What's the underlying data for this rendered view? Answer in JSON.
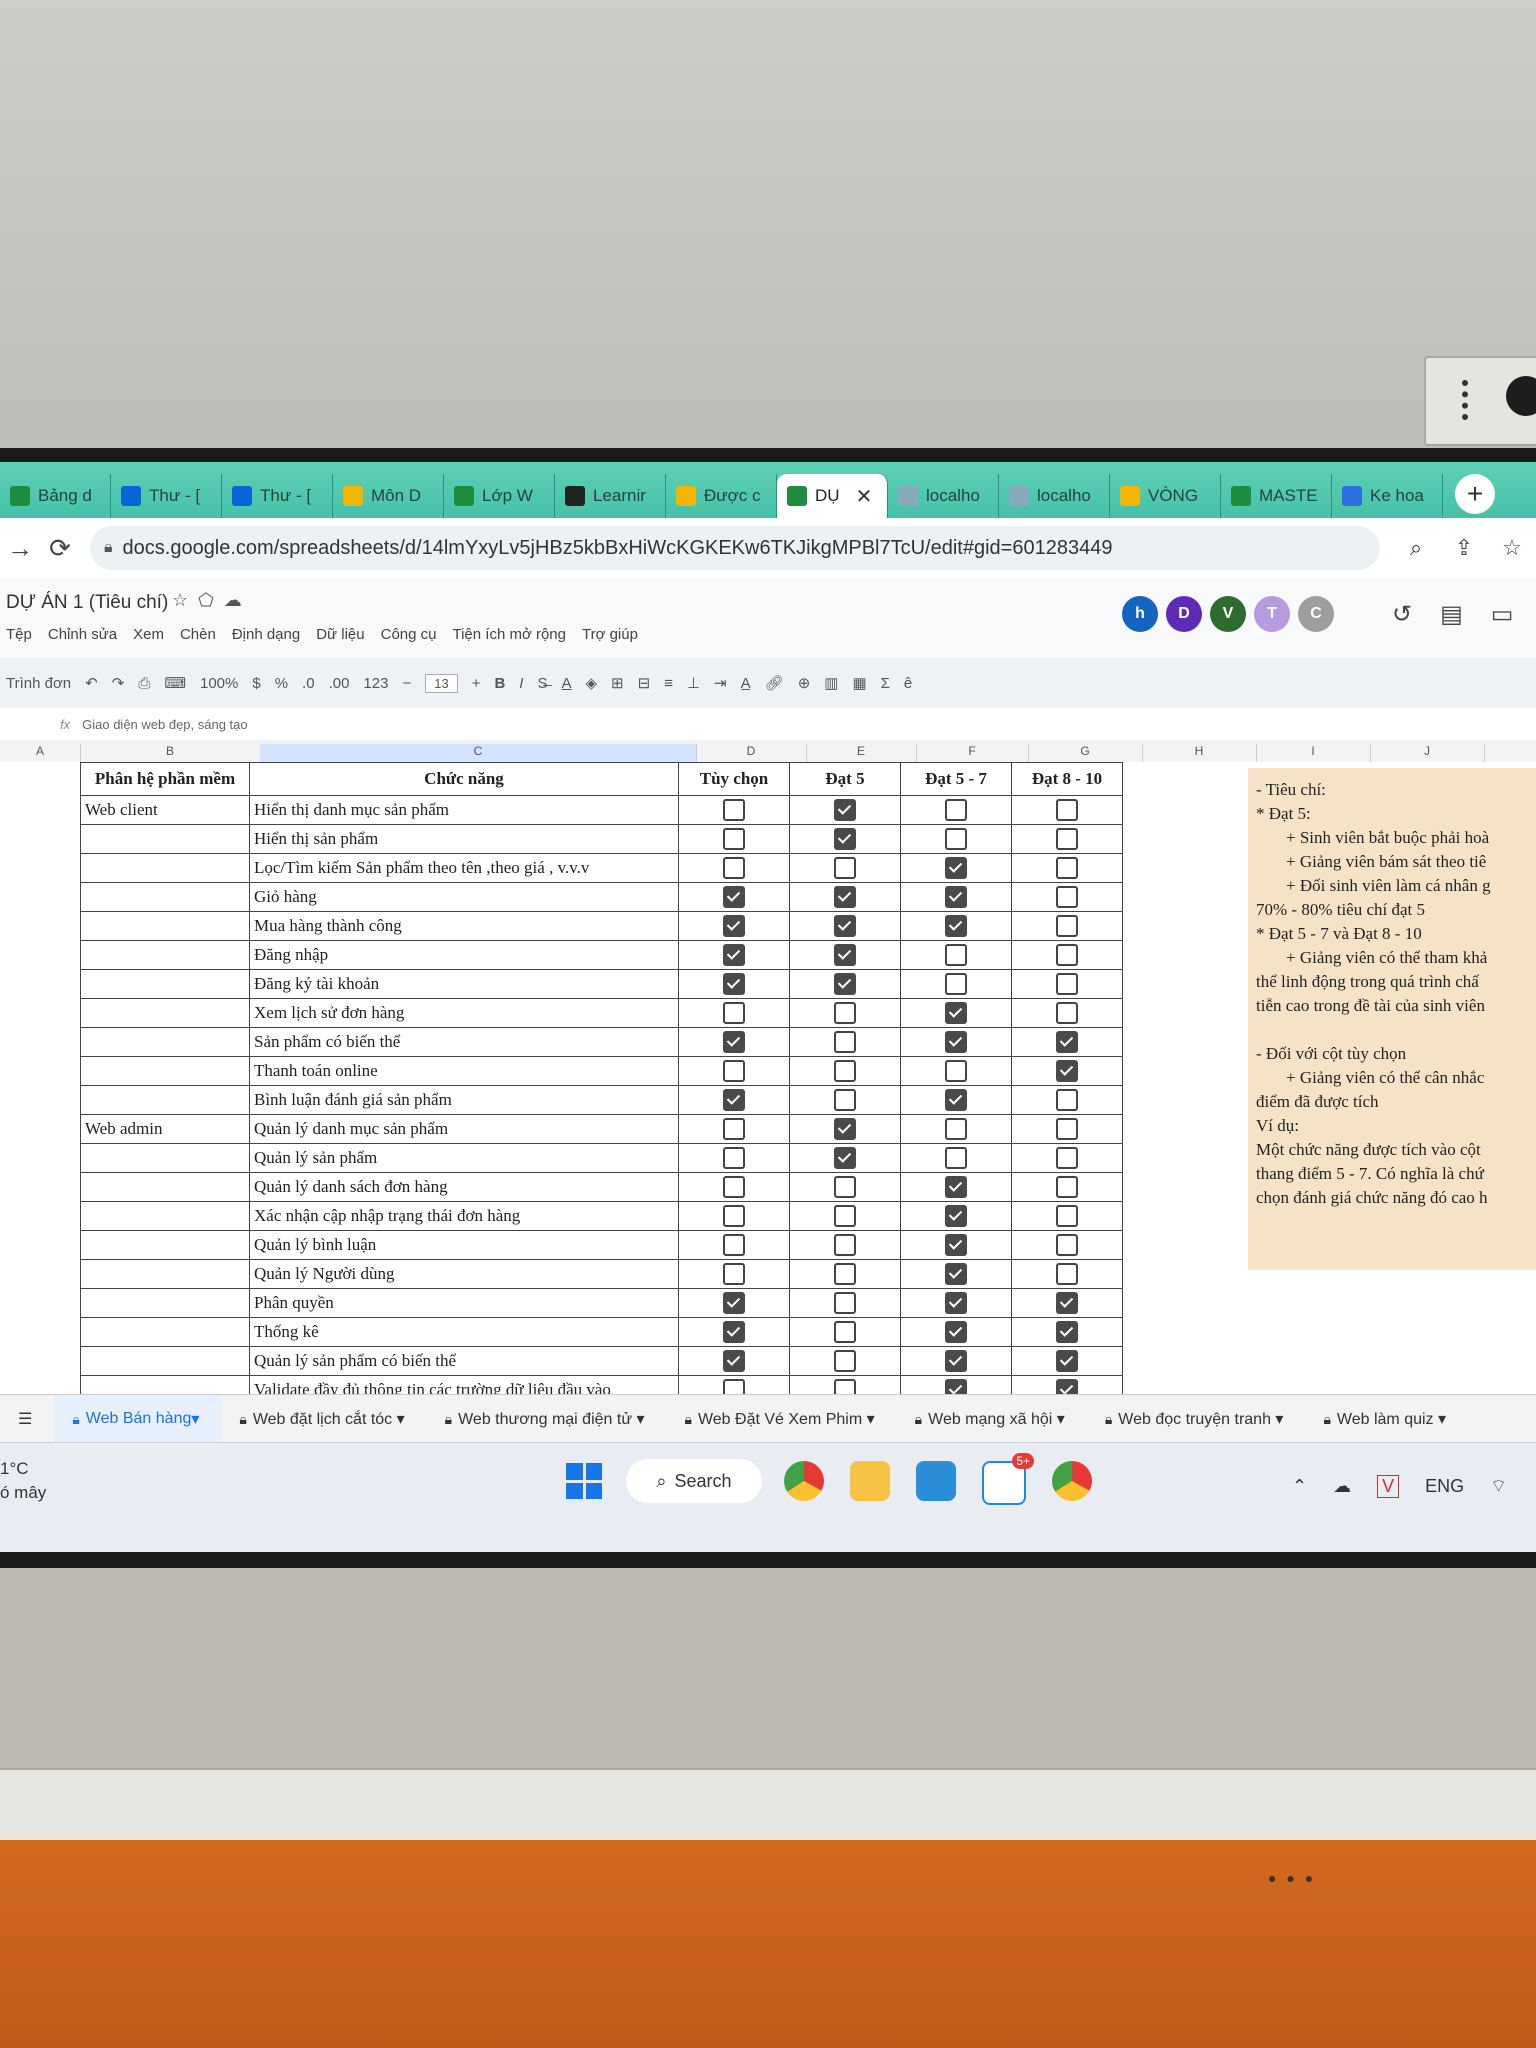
{
  "browser": {
    "tabs": [
      {
        "label": "Bảng d",
        "icon": "sheets-icon"
      },
      {
        "label": "Thư - [",
        "icon": "outlook-icon"
      },
      {
        "label": "Thư - [",
        "icon": "outlook-icon"
      },
      {
        "label": "Môn D",
        "icon": "drive-icon"
      },
      {
        "label": "Lớp W",
        "icon": "sheets-icon"
      },
      {
        "label": "Learnir",
        "icon": "learning-icon"
      },
      {
        "label": "Được c",
        "icon": "drive-icon"
      },
      {
        "label": "DỤ",
        "icon": "sheets-icon",
        "active": true
      },
      {
        "label": "localho",
        "icon": "page-icon"
      },
      {
        "label": "localho",
        "icon": "page-icon"
      },
      {
        "label": "VÒNG",
        "icon": "drive-icon"
      },
      {
        "label": "MASTE",
        "icon": "sheets-icon"
      },
      {
        "label": "Ke hoa",
        "icon": "docs-icon"
      }
    ],
    "new_tab": "+",
    "url": "docs.google.com/spreadsheets/d/14lmYxyLv5jHBz5kbBxHiWcKGKEKw6TKJikgMPBl7TcU/edit#gid=601283449"
  },
  "doc": {
    "title": "DỰ ÁN 1 (Tiêu chí)",
    "menu": [
      "Tệp",
      "Chỉnh sửa",
      "Xem",
      "Chèn",
      "Định dạng",
      "Dữ liệu",
      "Công cụ",
      "Tiện ích mở rộng",
      "Trợ giúp"
    ],
    "avatars": [
      {
        "letter": "h",
        "color": "#1565c0"
      },
      {
        "letter": "D",
        "color": "#5e2bb8"
      },
      {
        "letter": "V",
        "color": "#2e6b2e"
      },
      {
        "letter": "T",
        "color": "#b79be0"
      },
      {
        "letter": "C",
        "color": "#9e9e9e"
      }
    ]
  },
  "toolbar": {
    "menus": "Trình đơn",
    "zoom": "100%",
    "currency": "$",
    "percent": "%",
    "dec_less": ".0",
    "dec_more": ".00",
    "number_format": "123",
    "font_size": "13",
    "bold": "B",
    "italic": "I",
    "font_color": "A",
    "sum": "Σ"
  },
  "formula_bar": {
    "fx": "fx",
    "content": "Giao diện web đẹp, sáng tạo"
  },
  "columns": [
    "A",
    "B",
    "C",
    "D",
    "E",
    "F",
    "G",
    "H",
    "I",
    "J"
  ],
  "table": {
    "header_b": "Phân hệ phần mềm",
    "header_c": "Chức năng",
    "header_d": "Tùy chọn",
    "header_e": "Đạt 5",
    "header_f": "Đạt 5 - 7",
    "header_g": "Đạt 8 - 10",
    "rows": [
      {
        "group": "Web client",
        "feature": "Hiển thị danh mục sản phẩm",
        "checks": [
          false,
          true,
          false,
          false
        ]
      },
      {
        "group": "",
        "feature": "Hiển thị sản phẩm",
        "checks": [
          false,
          true,
          false,
          false
        ]
      },
      {
        "group": "",
        "feature": "Lọc/Tìm kiếm Sản phẩm theo tên ,theo giá , v.v.v",
        "checks": [
          false,
          false,
          true,
          false
        ]
      },
      {
        "group": "",
        "feature": "Giỏ hàng",
        "checks": [
          true,
          true,
          true,
          false
        ]
      },
      {
        "group": "",
        "feature": "Mua hàng thành công",
        "checks": [
          true,
          true,
          true,
          false
        ]
      },
      {
        "group": "",
        "feature": "Đăng nhập",
        "checks": [
          true,
          true,
          false,
          false
        ]
      },
      {
        "group": "",
        "feature": "Đăng ký tài khoản",
        "checks": [
          true,
          true,
          false,
          false
        ]
      },
      {
        "group": "",
        "feature": "Xem lịch sử đơn hàng",
        "checks": [
          false,
          false,
          true,
          false
        ]
      },
      {
        "group": "",
        "feature": "Sản phẩm có biến thể",
        "checks": [
          true,
          false,
          true,
          true
        ]
      },
      {
        "group": "",
        "feature": "Thanh toán online",
        "checks": [
          false,
          false,
          false,
          true
        ]
      },
      {
        "group": "",
        "feature": "Bình luận đánh giá sản phẩm",
        "checks": [
          true,
          false,
          true,
          false
        ]
      },
      {
        "group": "Web admin",
        "feature": "Quản lý danh mục sản phẩm",
        "checks": [
          false,
          true,
          false,
          false
        ]
      },
      {
        "group": "",
        "feature": "Quản lý sản phẩm",
        "checks": [
          false,
          true,
          false,
          false
        ]
      },
      {
        "group": "",
        "feature": "Quản lý danh sách đơn hàng",
        "checks": [
          false,
          false,
          true,
          false
        ]
      },
      {
        "group": "",
        "feature": "Xác nhận cập nhập trạng thái đơn hàng",
        "checks": [
          false,
          false,
          true,
          false
        ]
      },
      {
        "group": "",
        "feature": "Quản lý bình luận",
        "checks": [
          false,
          false,
          true,
          false
        ]
      },
      {
        "group": "",
        "feature": "Quản lý Người dùng",
        "checks": [
          false,
          false,
          true,
          false
        ]
      },
      {
        "group": "",
        "feature": "Phân quyền",
        "checks": [
          true,
          false,
          true,
          true
        ]
      },
      {
        "group": "",
        "feature": "Thống kê",
        "checks": [
          true,
          false,
          true,
          true
        ]
      },
      {
        "group": "",
        "feature": "Quản lý sản phẩm có biến thể",
        "checks": [
          true,
          false,
          true,
          true
        ]
      },
      {
        "group": "",
        "feature": "Validate đầy đủ thông tin các trường dữ liệu đầu vào",
        "checks": [
          false,
          false,
          true,
          true
        ]
      }
    ]
  },
  "notes": {
    "l1": "- Tiêu chí:",
    "l2": "* Đạt 5:",
    "l3": "+ Sinh viên bắt buộc phải hoà",
    "l4": "+ Giảng viên bám sát theo tiê",
    "l5": "+ Đối sinh viên làm cá nhân g",
    "l6": "70% - 80% tiêu chí đạt 5",
    "l7": "* Đạt 5 - 7 và Đạt 8 - 10",
    "l8": "+ Giảng viên có thể tham khả",
    "l9": "thể linh động trong quá trình chấ",
    "l10": "tiễn cao trong đề tài của sinh viên",
    "l11": "- Đối với cột tùy chọn",
    "l12": "+ Giảng viên có thể cân nhắc",
    "l13": "điểm đã được tích",
    "l14": "Ví dụ:",
    "l15": "Một chức năng được tích vào cột",
    "l16": "thang điểm 5 - 7. Có nghĩa là chứ",
    "l17": "chọn đánh giá chức năng đó cao h"
  },
  "sheet_tabs": [
    {
      "label": "Web Bán hàng",
      "active": true
    },
    {
      "label": "Web đặt lịch cắt tóc"
    },
    {
      "label": "Web thương mại điện tử"
    },
    {
      "label": "Web Đặt Vé Xem Phim"
    },
    {
      "label": "Web mạng xã hội"
    },
    {
      "label": "Web đọc truyện tranh"
    },
    {
      "label": "Web làm quiz"
    }
  ],
  "taskbar": {
    "weather_temp": "1°C",
    "weather_desc": "ó mây",
    "search": "Search",
    "zalo_badge": "5+",
    "lang": "ENG"
  }
}
